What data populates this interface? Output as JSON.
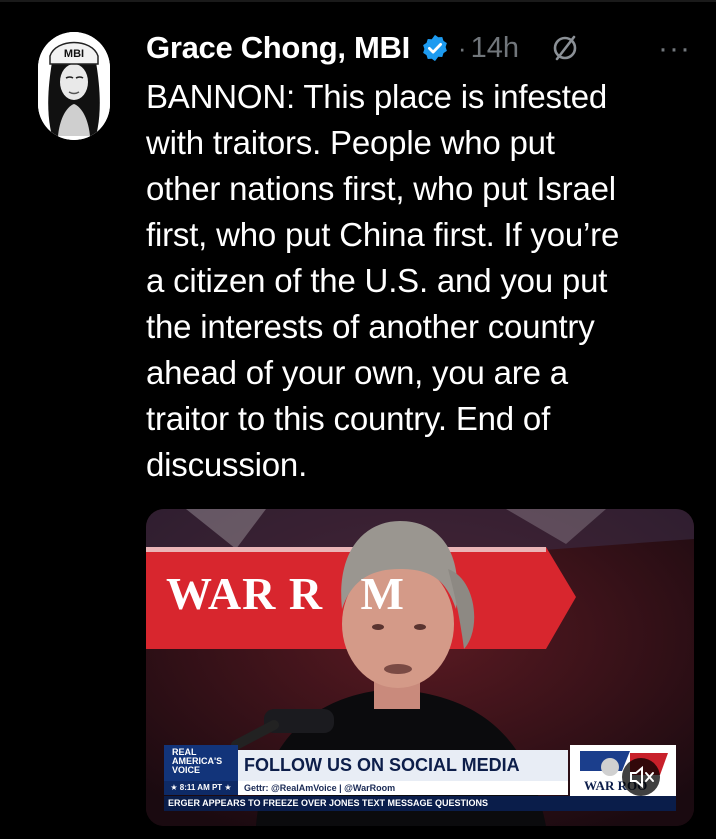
{
  "tweet": {
    "author": {
      "name": "Grace Chong, MBI",
      "avatar_text": "MBI",
      "verified": true
    },
    "separator": "·",
    "time": "14h",
    "mute_icon": "mute-circle-slash-icon",
    "more_icon": "more-dots-icon",
    "more_label": "···",
    "text": "BANNON: This place is infested\nwith traitors. People who put\nother nations first, who put Israel\nfirst, who put China first. If you’re\na citizen of the U.S. and you put\nthe interests of another country\nahead of your own, you are a\ntraitor to this country. End of\ndiscussion."
  },
  "media": {
    "banner_text": "WAR R   M",
    "mute_overlay_icon": "speaker-muted-icon",
    "chyron": {
      "network_logo": "REAL AMERICA'S VOICE",
      "time": "★ 8:11 AM PT ★",
      "headline": "FOLLOW US ON SOCIAL MEDIA",
      "social": "Gettr: @RealAmVoice | @WarRoom",
      "ticker": "ERGER APPEARS TO FREEZE OVER JONES TEXT MESSAGE QUESTIONS",
      "show_logo": "WAR ROO"
    }
  },
  "colors": {
    "background": "#000000",
    "text": "#ffffff",
    "muted": "#71767b",
    "verified": "#1d9bf0",
    "banner_red": "#d8262e"
  }
}
